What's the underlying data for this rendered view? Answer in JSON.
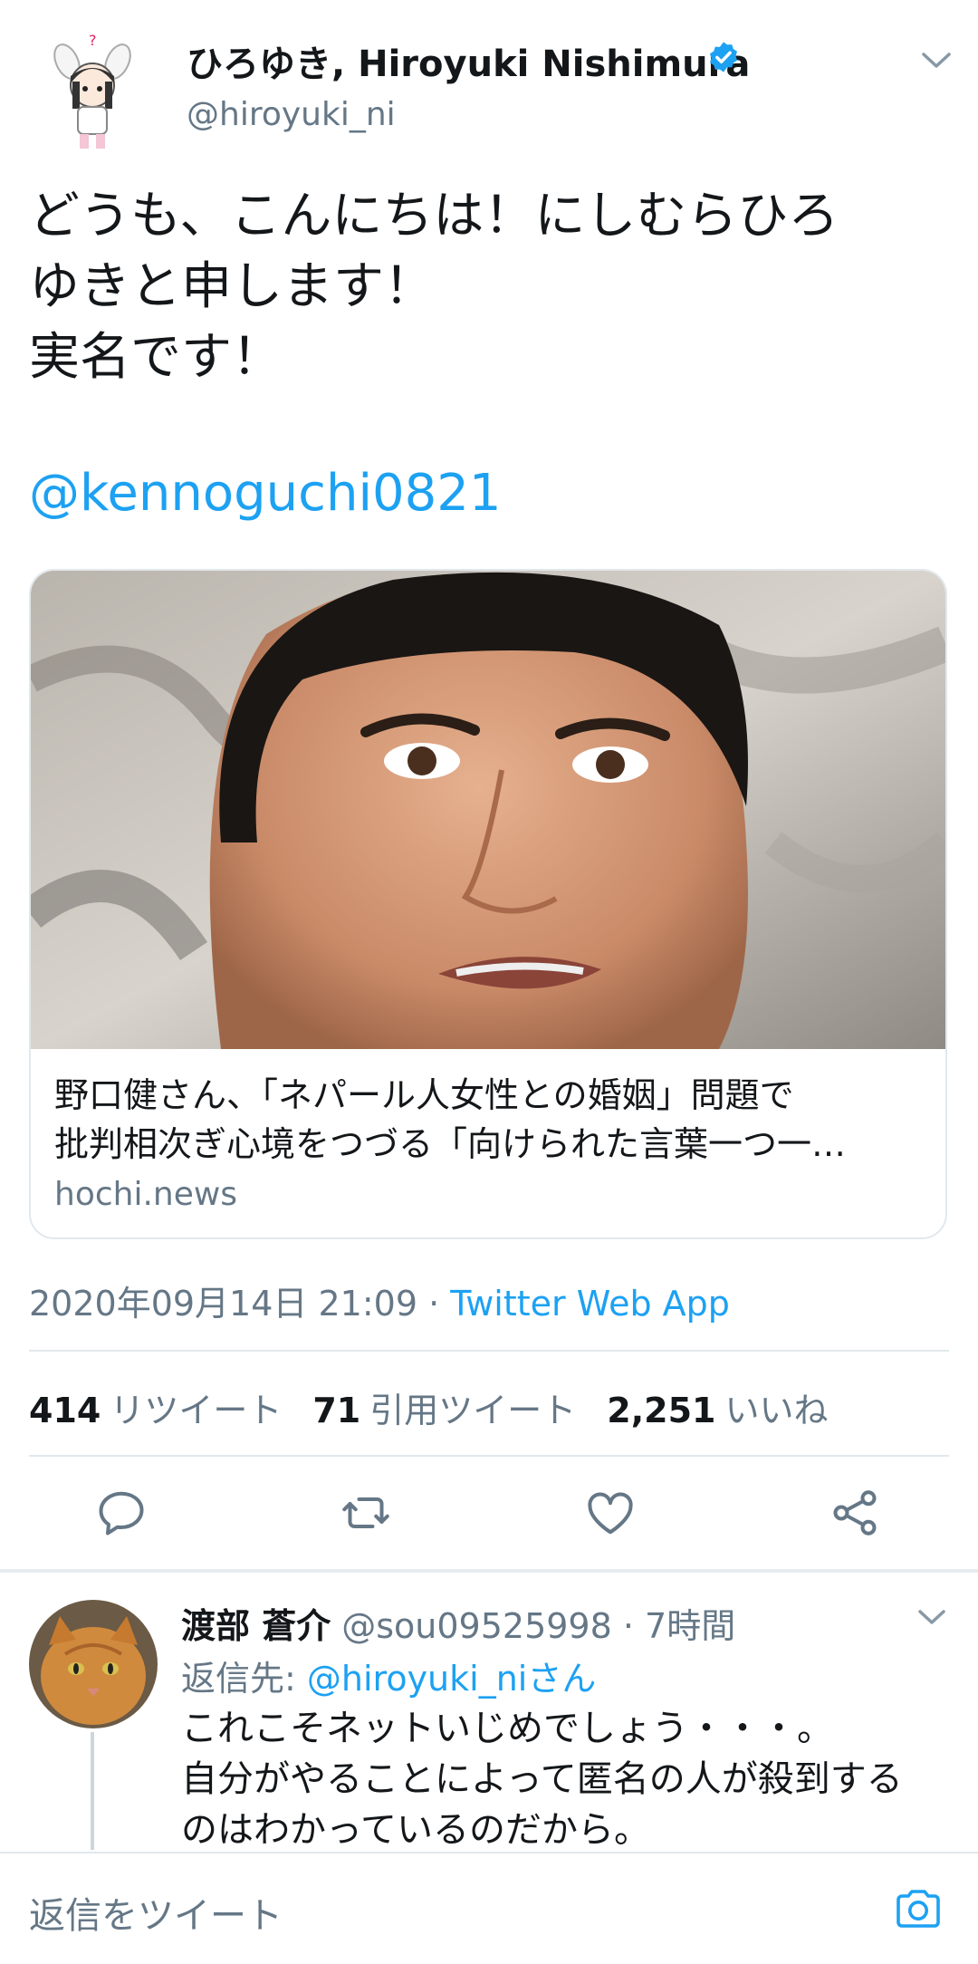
{
  "tweet": {
    "author_name": "ひろゆき, Hiroyuki Nishimura",
    "author_handle": "@hiroyuki_ni",
    "text_lines": [
      "どうも、こんにちは！にしむらひろ",
      "ゆきと申します！",
      "実名です！"
    ],
    "mention": "@kenno​guchi0821",
    "card": {
      "title_lines": [
        "野口健さん、「ネパール人女性との婚姻」問題で",
        "批判相次ぎ心境をつづる「向けられた言葉一つ一…"
      ],
      "domain": "hochi.news"
    },
    "timestamp": "2020年09月14日 21:09",
    "separator": "·",
    "source": "Twitter Web App",
    "stats": {
      "retweets": "414",
      "retweets_label": "リツイート",
      "quotes": "71",
      "quotes_label": "引用ツイート",
      "likes": "2,251",
      "likes_label": "いいね"
    }
  },
  "reply": {
    "name": "渡部 蒼介",
    "handle": "@sou09525998 · 7時間",
    "reply_to_prefix": "返信先: ",
    "reply_to_link": "@hiroyuki_niさん",
    "body_lines": [
      "これこそネットいじめでしょう・・・。",
      "自分がやることによって匿名の人が殺到する",
      "のはわかっているのだから。"
    ]
  },
  "compose": {
    "placeholder": "返信をツイート"
  },
  "colors": {
    "accent": "#1da1f2",
    "secondary_text": "#657786",
    "divider": "#e1e8ed"
  },
  "icons": [
    "chevron-down-icon",
    "verified-badge-icon",
    "reply-icon",
    "retweet-icon",
    "like-icon",
    "share-icon",
    "camera-icon"
  ]
}
